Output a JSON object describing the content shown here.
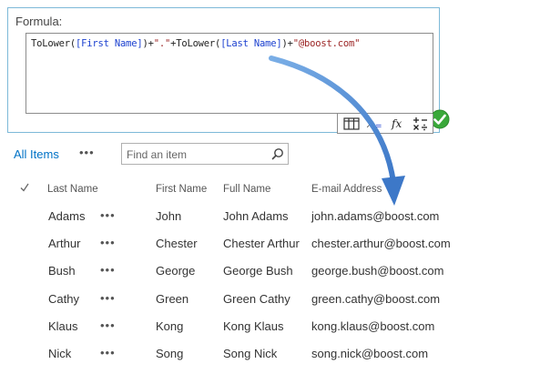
{
  "formula": {
    "label": "Formula:",
    "parts": [
      {
        "text": "ToLower(",
        "kind": "func"
      },
      {
        "text": "[First Name]",
        "kind": "field"
      },
      {
        "text": ")+",
        "kind": "func"
      },
      {
        "text": "\".\"",
        "kind": "str"
      },
      {
        "text": "+ToLower(",
        "kind": "func"
      },
      {
        "text": "[Last Name]",
        "kind": "field"
      },
      {
        "text": ")+",
        "kind": "func"
      },
      {
        "text": "\"@boost.com\"",
        "kind": "str"
      }
    ],
    "tools": [
      "columns-icon",
      "variable-icon",
      "function-icon",
      "operators-icon"
    ]
  },
  "colors": {
    "accent": "#0072c6",
    "check_green": "#3aa83a",
    "arrow": "#5b8fd6"
  },
  "list": {
    "view_tab": "All Items",
    "more": "•••",
    "search_placeholder": "Find an item",
    "headers": {
      "last": "Last Name",
      "first": "First Name",
      "full": "Full Name",
      "email": "E-mail Address"
    },
    "rows": [
      {
        "last": "Adams",
        "first": "John",
        "full": "John Adams",
        "email": "john.adams@boost.com"
      },
      {
        "last": "Arthur",
        "first": "Chester",
        "full": "Chester Arthur",
        "email": "chester.arthur@boost.com"
      },
      {
        "last": "Bush",
        "first": "George",
        "full": "George Bush",
        "email": "george.bush@boost.com"
      },
      {
        "last": "Cathy",
        "first": "Green",
        "full": "Green Cathy",
        "email": "green.cathy@boost.com"
      },
      {
        "last": "Klaus",
        "first": "Kong",
        "full": "Kong Klaus",
        "email": "kong.klaus@boost.com"
      },
      {
        "last": "Nick",
        "first": "Song",
        "full": "Song Nick",
        "email": "song.nick@boost.com"
      }
    ],
    "row_more": "•••"
  }
}
